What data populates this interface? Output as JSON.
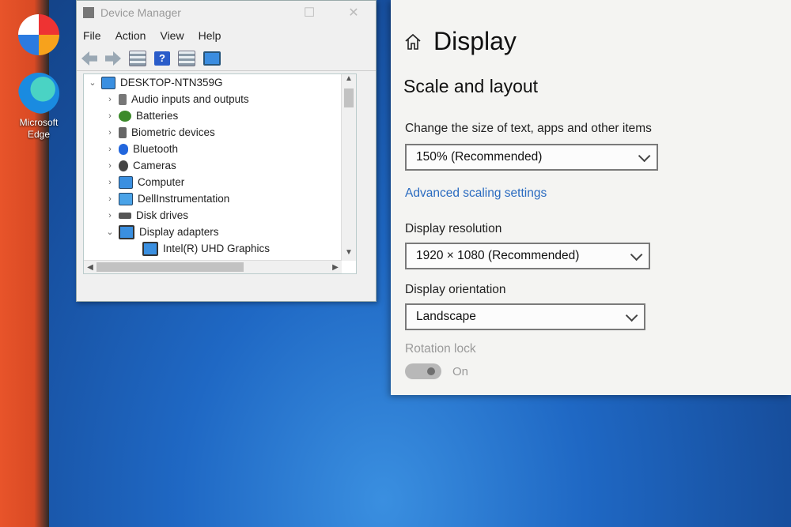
{
  "desktop": {
    "icons": [
      {
        "label": ""
      },
      {
        "label": "Microsoft Edge"
      }
    ]
  },
  "device_manager": {
    "title": "Device Manager",
    "menu": [
      "File",
      "Action",
      "View",
      "Help"
    ],
    "tree": {
      "root": "DESKTOP-NTN359G",
      "categories": [
        "Audio inputs and outputs",
        "Batteries",
        "Biometric devices",
        "Bluetooth",
        "Cameras",
        "Computer",
        "DellInstrumentation",
        "Disk drives",
        "Display adapters"
      ],
      "display_child": "Intel(R) UHD Graphics"
    }
  },
  "settings": {
    "page_title": "Display",
    "section_title": "Scale and layout",
    "scale_label": "Change the size of text, apps and other items",
    "scale_value": "150% (Recommended)",
    "advanced_link": "Advanced scaling settings",
    "resolution_label": "Display resolution",
    "resolution_value": "1920 × 1080 (Recommended)",
    "orientation_label": "Display orientation",
    "orientation_value": "Landscape",
    "rotation_lock_label": "Rotation lock",
    "rotation_lock_state": "On"
  }
}
